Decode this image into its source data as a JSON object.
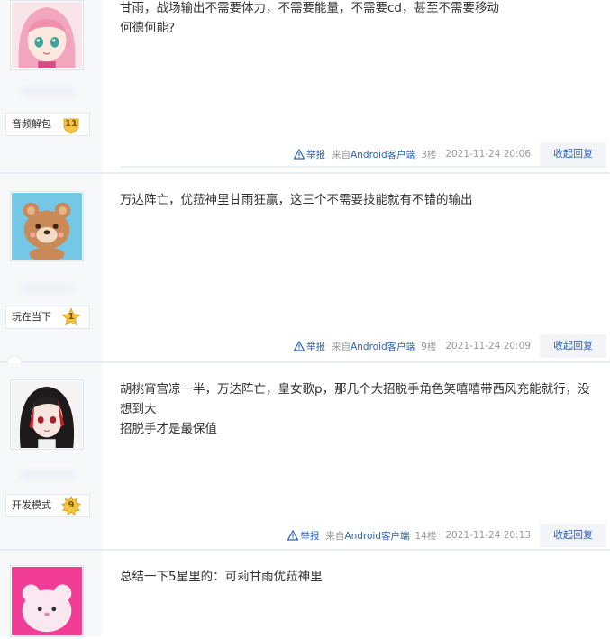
{
  "posts": [
    {
      "content": [
        "甘雨，战场输出不需要体力，不需要能量，不需要cd，甚至不需要移动",
        "何德何能?"
      ],
      "level_title": "音频解包",
      "level": "11",
      "report": "举报",
      "client_prefix": "来自",
      "client": "Android客户端",
      "floor": "3楼",
      "time": "2021-11-24 20:06",
      "reply_label": "收起回复",
      "avatar": "anime-girl-pink-hair-avatar"
    },
    {
      "content": [
        "万达阵亡，优菈神里甘雨狂赢，这三个不需要技能就有不错的输出"
      ],
      "level_title": "玩在当下",
      "level": "1",
      "report": "举报",
      "client_prefix": "来自",
      "client": "Android客户端",
      "floor": "9楼",
      "time": "2021-11-24 20:09",
      "reply_label": "收起回复",
      "avatar": "cartoon-bear-avatar"
    },
    {
      "content": [
        "胡桃宵宫凉一半，万达阵亡，皇女歌p，那几个大招脱手角色笑嘻嘻带西风充能就行，没想到大",
        "招脱手才是最保值"
      ],
      "level_title": "开发模式",
      "level": "9",
      "report": "举报",
      "client_prefix": "来自",
      "client": "Android客户端",
      "floor": "14楼",
      "time": "2021-11-24 20:13",
      "reply_label": "收起回复",
      "avatar": "anime-girl-black-red-hair-avatar"
    },
    {
      "content": [
        "总结一下5星里的：可莉甘雨优菈神里"
      ],
      "avatar": "pink-fluffy-creature-avatar"
    }
  ],
  "colors": {
    "link": "#2d64b3",
    "sidebar": "#f7f8fa",
    "badge_gold": "#f5c542",
    "badge_orange": "#f0a830"
  }
}
